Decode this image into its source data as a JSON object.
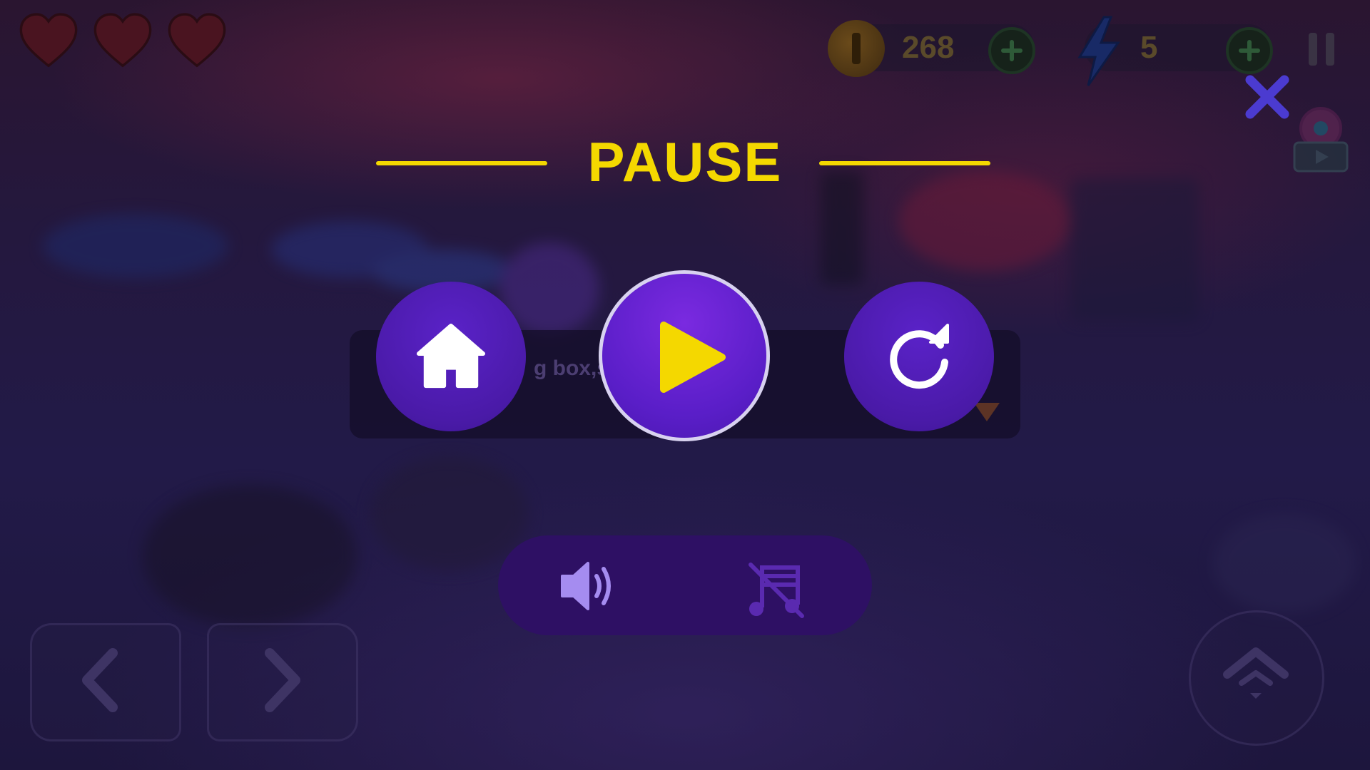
{
  "hud": {
    "hearts": 3,
    "coins": "268",
    "energy": "5"
  },
  "pause_menu": {
    "title": "PAUSE",
    "buttons": {
      "home": "home-icon",
      "resume": "play-icon",
      "restart": "restart-icon"
    },
    "sound_effects": "on",
    "music": "off"
  },
  "background_hint": {
    "text": "g box,sa"
  },
  "colors": {
    "accent_yellow": "#f4d800",
    "button_purple": "#4a1aa8",
    "sound_bar": "#2e1064",
    "close_x": "#4b3bd0"
  }
}
